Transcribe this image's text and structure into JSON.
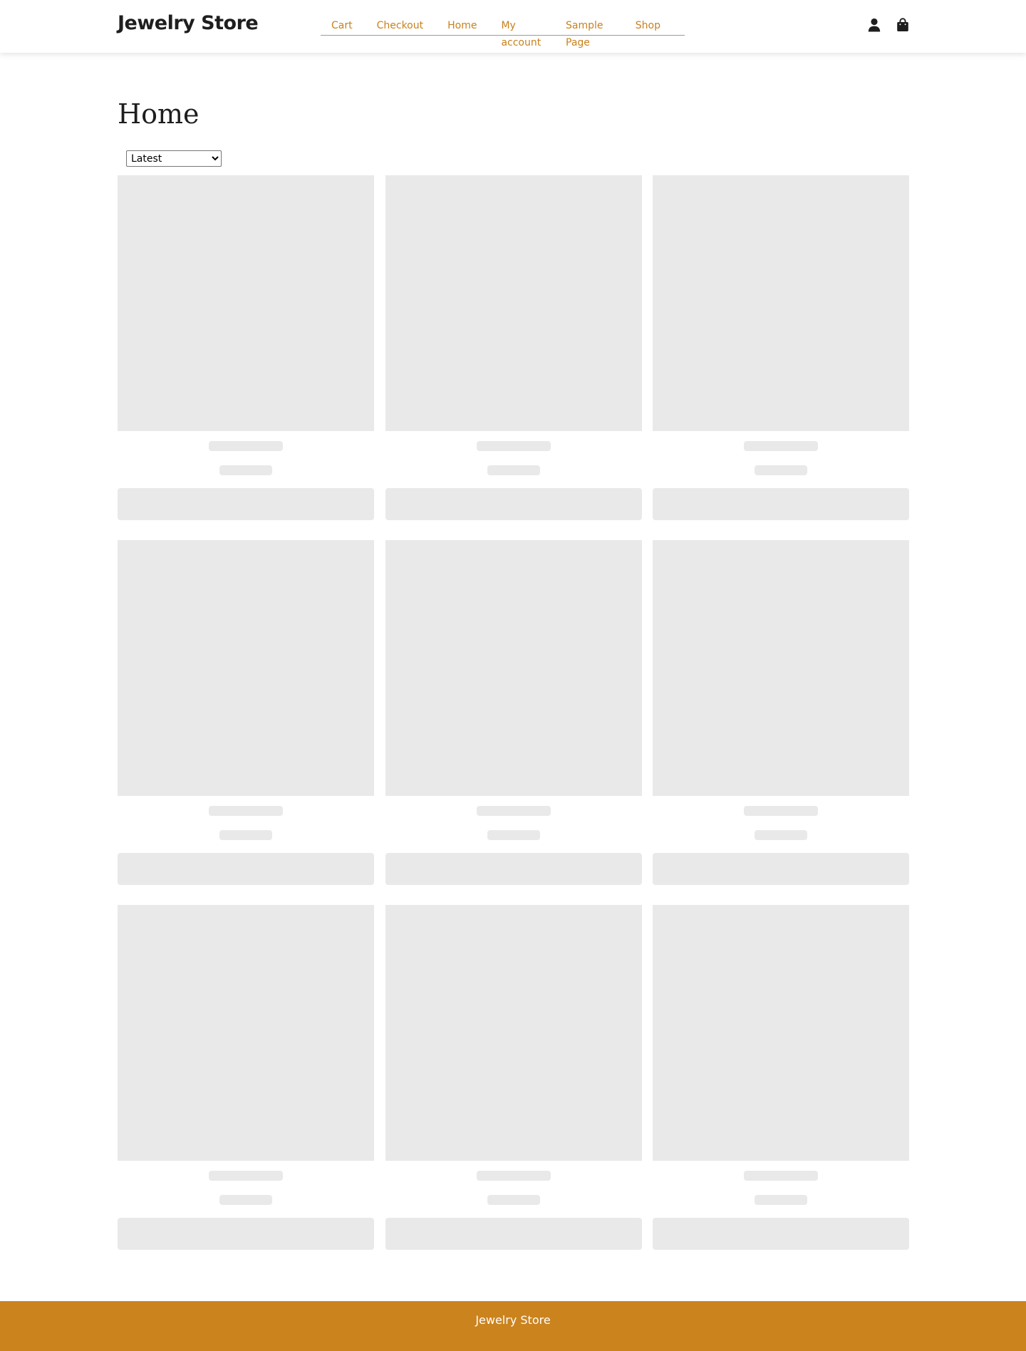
{
  "header": {
    "site_title": "Jewelry Store",
    "nav": [
      "Cart",
      "Checkout",
      "Home",
      "My account",
      "Sample Page",
      "Shop"
    ],
    "icons": [
      "user-icon",
      "shopping-bag-icon"
    ]
  },
  "main": {
    "page_title": "Home",
    "sort": {
      "selected": "Latest",
      "options": [
        "Latest"
      ]
    },
    "products_loading": 9
  },
  "footer": {
    "text": "Jewelry Store"
  },
  "colors": {
    "accent": "#cb831e",
    "link": "#c8811c",
    "placeholder": "#e9e9e9",
    "text": "#1e1e1e"
  }
}
